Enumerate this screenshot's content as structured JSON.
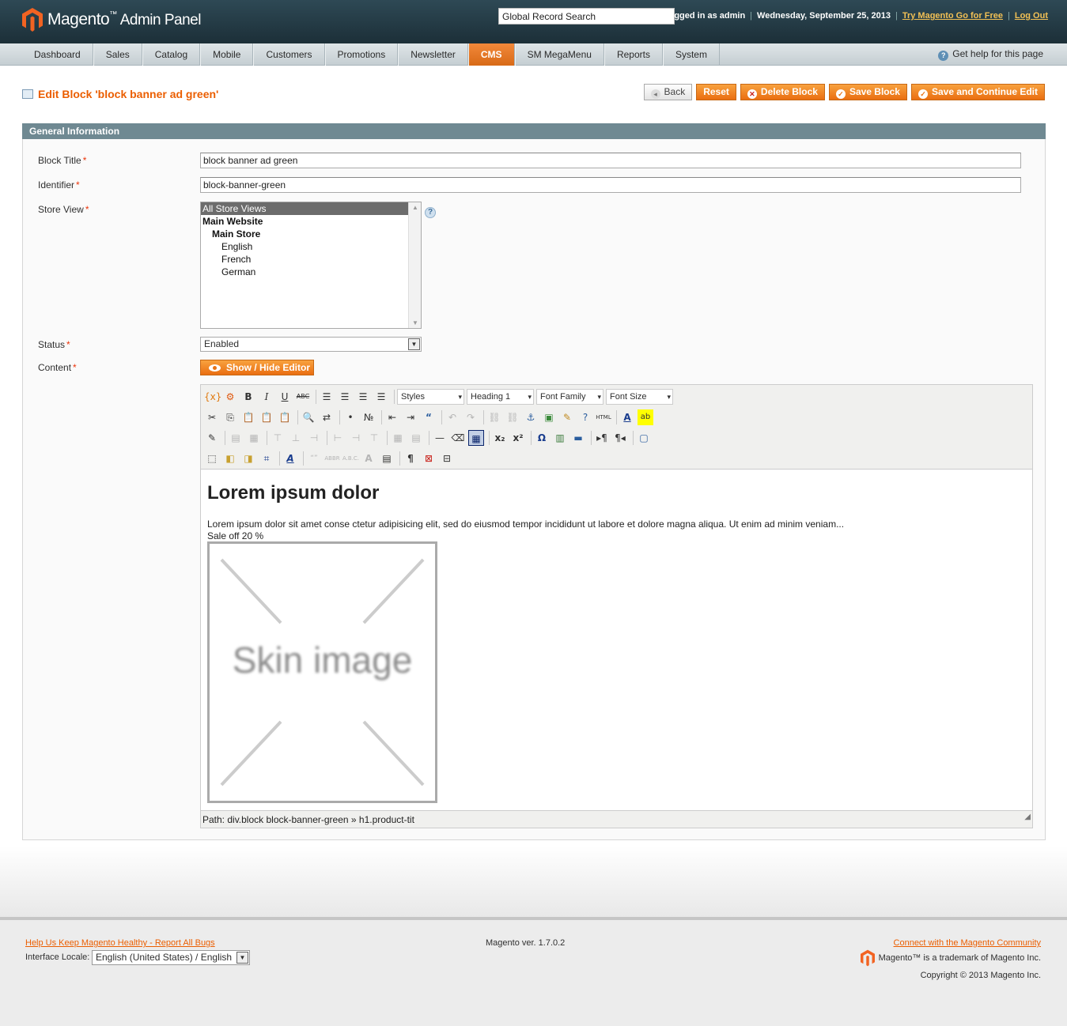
{
  "header": {
    "brand": "Magento",
    "brand_tm": "™",
    "brand_sub": "Admin Panel",
    "search_placeholder": "Global Record Search",
    "logged_in": "Logged in as admin",
    "date": "Wednesday, September 25, 2013",
    "try_link": "Try Magento Go for Free",
    "logout": "Log Out"
  },
  "nav": {
    "items": [
      "Dashboard",
      "Sales",
      "Catalog",
      "Mobile",
      "Customers",
      "Promotions",
      "Newsletter",
      "CMS",
      "SM MegaMenu",
      "Reports",
      "System"
    ],
    "active": "CMS",
    "help": "Get help for this page"
  },
  "page": {
    "title": "Edit Block 'block banner ad green'",
    "buttons": {
      "back": "Back",
      "reset": "Reset",
      "delete": "Delete Block",
      "save": "Save Block",
      "save_continue": "Save and Continue Edit"
    }
  },
  "form": {
    "section": "General Information",
    "block_title_label": "Block Title",
    "block_title_value": "block banner ad green",
    "identifier_label": "Identifier",
    "identifier_value": "block-banner-green",
    "store_view_label": "Store View",
    "store_views": [
      {
        "label": "All Store Views",
        "level": 0,
        "selected": true,
        "group": false
      },
      {
        "label": "Main Website",
        "level": 0,
        "selected": false,
        "group": true
      },
      {
        "label": "Main Store",
        "level": 1,
        "selected": false,
        "group": true
      },
      {
        "label": "English",
        "level": 2,
        "selected": false,
        "group": false
      },
      {
        "label": "French",
        "level": 2,
        "selected": false,
        "group": false
      },
      {
        "label": "German",
        "level": 2,
        "selected": false,
        "group": false
      }
    ],
    "status_label": "Status",
    "status_value": "Enabled",
    "content_label": "Content",
    "required_mark": "*",
    "show_hide": "Show / Hide Editor"
  },
  "editor": {
    "styles": "Styles",
    "format": "Heading 1",
    "font_family": "Font Family",
    "font_size": "Font Size",
    "heading": "Lorem ipsum dolor",
    "paragraph": "Lorem ipsum dolor sit amet conse ctetur adipisicing elit, sed do eiusmod tempor incididunt ut labore et dolore magna aliqua. Ut enim ad minim veniam...",
    "sale": "Sale off 20 %",
    "image_text": "Skin image",
    "path": "Path: div.block block-banner-green » h1.product-tit"
  },
  "footer": {
    "report_bugs": "Help Us Keep Magento Healthy - Report All Bugs",
    "locale_label": "Interface Locale:",
    "locale_value": "English (United States) / English",
    "version": "Magento ver. 1.7.0.2",
    "community": "Connect with the Magento Community",
    "trademark": "Magento™ is a trademark of Magento Inc.",
    "copyright": "Copyright © 2013 Magento Inc."
  },
  "colors": {
    "accent": "#eb5e00",
    "header": "#1f333c",
    "section": "#6f8992"
  }
}
